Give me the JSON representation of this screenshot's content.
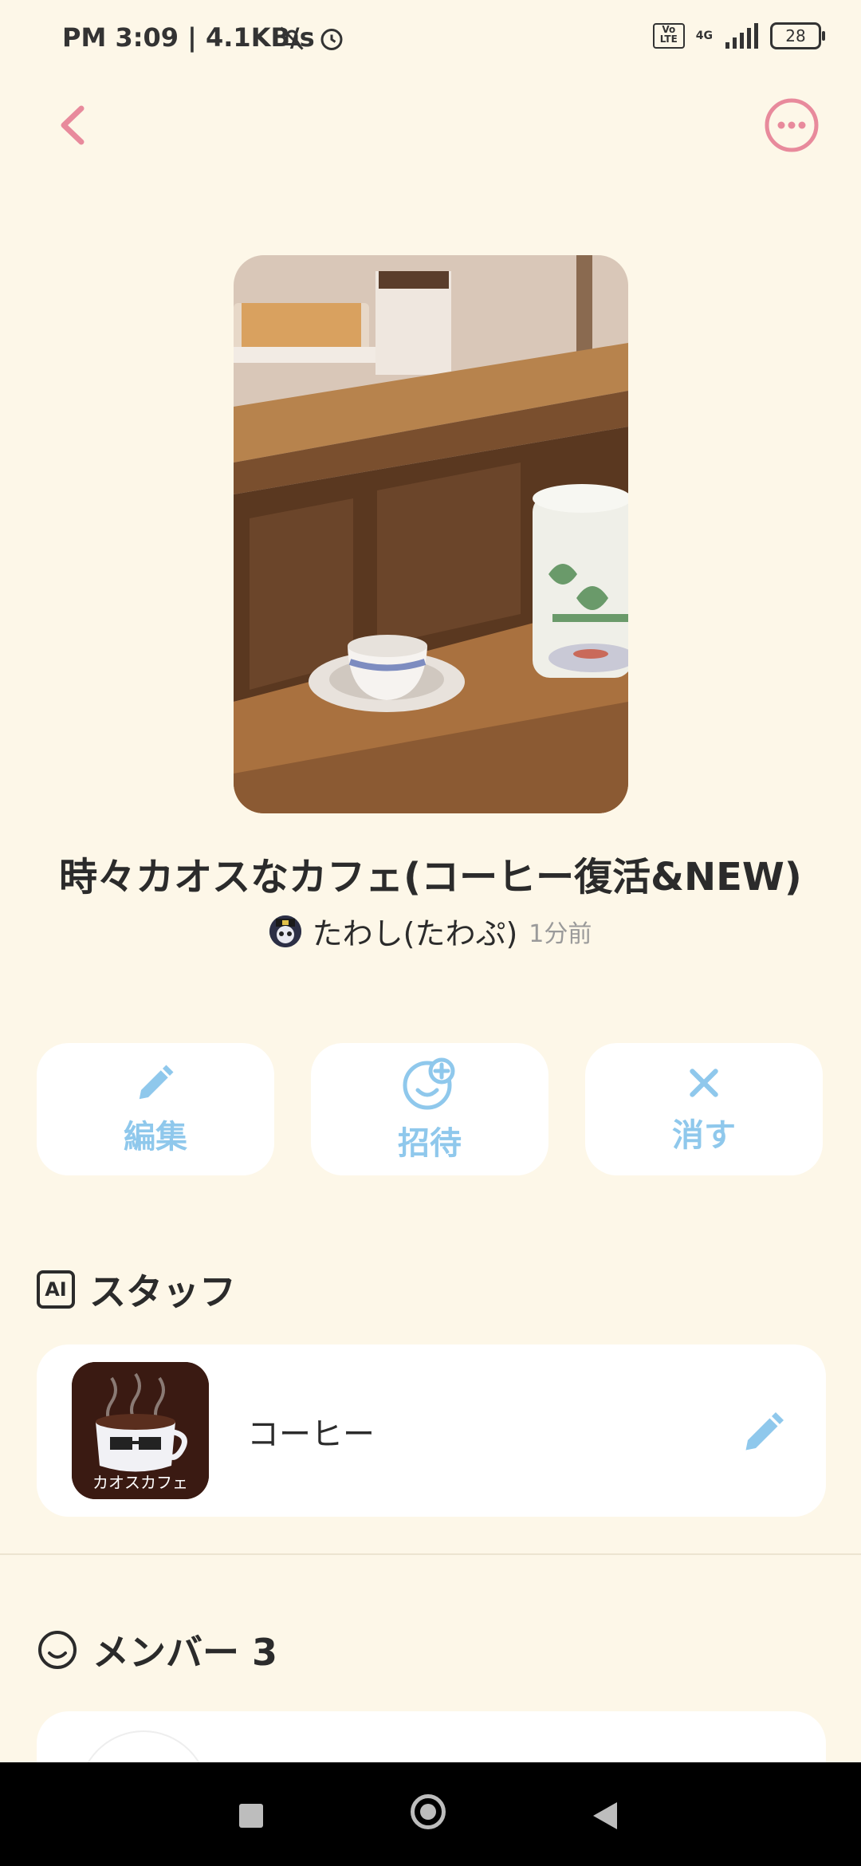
{
  "status_bar": {
    "time": "PM 3:09 | 4.1KB/s",
    "volte": "Vo LTE",
    "network": "4G",
    "battery": "28"
  },
  "room": {
    "title": "時々カオスなカフェ(コーヒー復活&NEW)",
    "author_name": "たわし(たわぷ)",
    "updated": "1分前"
  },
  "actions": {
    "edit_label": "編集",
    "invite_label": "招待",
    "delete_label": "消す"
  },
  "staff": {
    "title": "スタッフ",
    "ai_badge": "AI",
    "items": [
      {
        "name": "コーヒー",
        "thumb_caption": "カオスカフェ"
      }
    ]
  },
  "members": {
    "title": "メンバー 3"
  },
  "colors": {
    "accent_pink": "#e88a9c",
    "accent_blue": "#8fc8ec",
    "background": "#fdf7e8"
  }
}
